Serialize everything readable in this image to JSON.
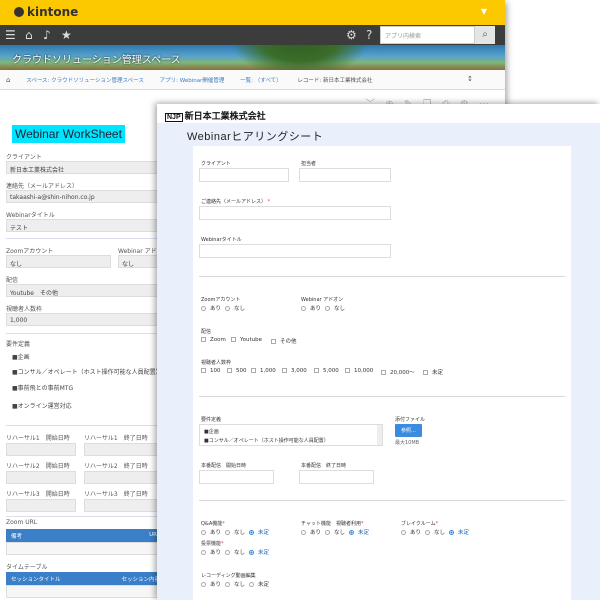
{
  "kintone": {
    "logo": "kintone",
    "search_placeholder": "アプリ内検索",
    "space_title": "クラウドソリューション管理スペース",
    "breadcrumb": [
      "スペース: クラウドソリューション管理スペース",
      "アプリ: Webinar開催管理",
      "一覧: （すべて）",
      "レコード: 新日本工業株式会社"
    ]
  },
  "worksheet": {
    "title": "Webinar WorkSheet",
    "client_label": "クライアント",
    "client_value": "新日本工業株式会社",
    "contact_label": "連絡先（メールアドレス）",
    "contact_value": "takaashi-a@shin-nihon.co.jp",
    "webinar_title_label": "Webinarタイトル",
    "webinar_title_value": "テスト",
    "zoom_account_label": "Zoomアカウント",
    "zoom_account_value": "なし",
    "webinar_addon_label": "Webinar アドオ",
    "webinar_addon_value": "なし",
    "delivery_label": "配信",
    "delivery_value": "Youtube　その他",
    "viewers_label": "視聴者人数枠",
    "viewers_value": "1,000",
    "requirements_label": "要件定義",
    "requirements": [
      "■企画",
      "■コンサル／オペレート（ホスト操作可能な人員配置）",
      "■事前飛との事前MTG",
      "■オンライン運営対応"
    ],
    "rehearsals": [
      {
        "start": "リハーサル1　開始日時",
        "end": "リハーサル1　終了日時"
      },
      {
        "start": "リハーサル2　開始日時",
        "end": "リハーサル2　終了日時"
      },
      {
        "start": "リハーサル3　開始日時",
        "end": "リハーサル3　終了日時"
      }
    ],
    "zoom_url_label": "Zoom URL",
    "zoom_url_col1": "備考",
    "zoom_url_col2": "URL",
    "timetable_label": "タイムテーブル",
    "timetable_col1": "セッションタイトル",
    "timetable_col2": "セッション内容"
  },
  "form": {
    "company_logo": "新日本工業株式会社",
    "logo_mark": "NJP",
    "title": "Webinarヒアリングシート",
    "client_label": "クライアント",
    "person_label": "担当者",
    "email_label": "ご連絡先（メールアドレス）",
    "email_required": "*",
    "webinar_title_label": "Webinarタイトル",
    "zoom_account_label": "Zoomアカウント",
    "zoom_account_options": [
      "あり",
      "なし"
    ],
    "addon_label": "Webinar アドオン",
    "addon_options": [
      "あり",
      "なし"
    ],
    "delivery_label": "配信",
    "delivery_options": [
      "Zoom",
      "Youtube",
      "その他"
    ],
    "viewers_label": "視聴者人数枠",
    "viewers_options": [
      "100",
      "500",
      "1,000",
      "3,000",
      "5,000",
      "10,000",
      "20,000〜",
      "未定"
    ],
    "requirements_label": "要件定義",
    "requirements_items": [
      "■企画",
      "■コンサル／オペレート（ホスト操作可能な人員配置）"
    ],
    "attachment_label": "添付ファイル",
    "attachment_button": "参照…",
    "attachment_note": "最大10MB",
    "live_start_label": "本番配信　開始日時",
    "live_end_label": "本番配信　終了日時",
    "qa_label": "Q&A機能",
    "qa_required": "*",
    "qa_options": [
      "あり",
      "なし",
      "未定"
    ],
    "chat_label": "チャット機能　視聴者利用",
    "chat_required": "*",
    "chat_options": [
      "あり",
      "なし",
      "未定"
    ],
    "breakout_label": "ブレイクルーム",
    "breakout_required": "*",
    "breakout_options": [
      "あり",
      "なし",
      "未定"
    ],
    "poll_label": "投票機能",
    "poll_required": "*",
    "poll_options": [
      "あり",
      "なし",
      "未定"
    ],
    "recording_label": "レコーディング動画編集",
    "recording_options": [
      "あり",
      "なし",
      "未定"
    ]
  }
}
